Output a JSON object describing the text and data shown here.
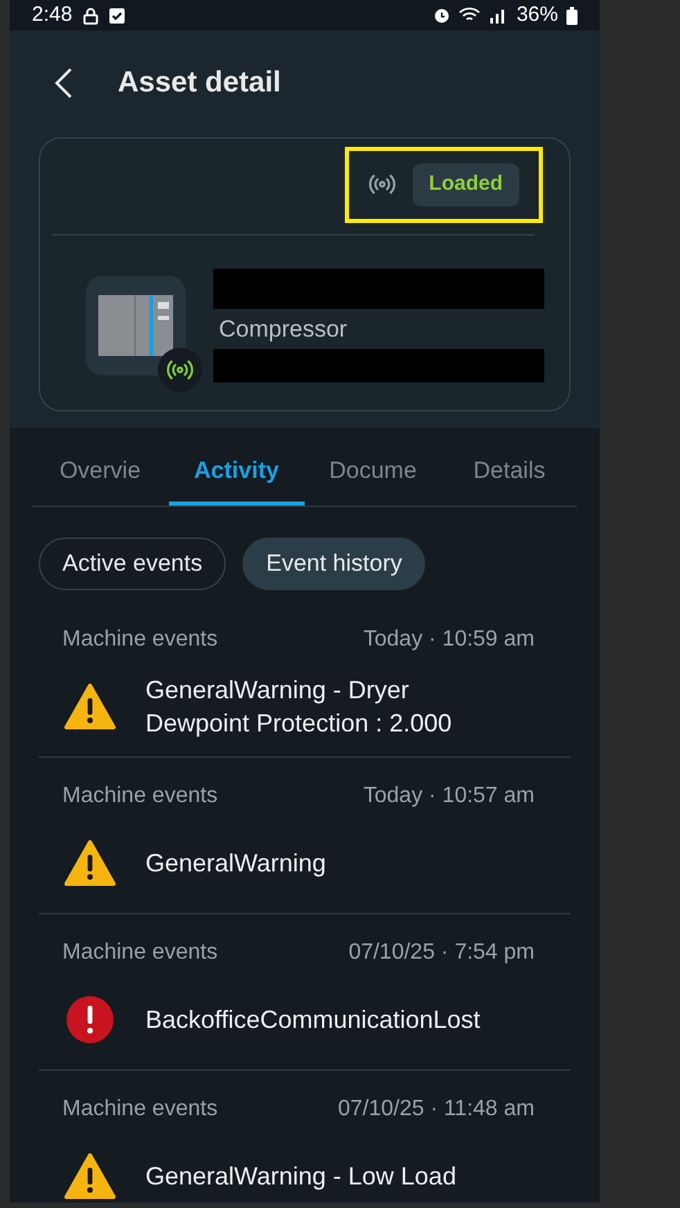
{
  "status_bar": {
    "time": "2:48",
    "battery": "36%"
  },
  "header": {
    "title": "Asset detail"
  },
  "asset": {
    "status": "Loaded",
    "type": "Compressor",
    "connected": true,
    "highlighted": true
  },
  "tabs": [
    {
      "label": "Overvie",
      "selected": false
    },
    {
      "label": "Activity",
      "selected": true
    },
    {
      "label": "Docume",
      "selected": false
    },
    {
      "label": "Details",
      "selected": false
    }
  ],
  "filters": [
    {
      "label": "Active events",
      "selected": false
    },
    {
      "label": "Event history",
      "selected": true
    }
  ],
  "events": [
    {
      "category": "Machine events",
      "time": "Today · 10:59 am",
      "title": "GeneralWarning - Dryer Dewpoint Protection : 2.000",
      "kind": "warning"
    },
    {
      "category": "Machine events",
      "time": "Today · 10:57 am",
      "title": "GeneralWarning",
      "kind": "warning"
    },
    {
      "category": "Machine events",
      "time": "07/10/25 · 7:54 pm",
      "title": "BackofficeCommunicationLost",
      "kind": "error"
    },
    {
      "category": "Machine events",
      "time": "07/10/25 · 11:48 am",
      "title": "GeneralWarning - Low Load",
      "kind": "warning"
    }
  ]
}
